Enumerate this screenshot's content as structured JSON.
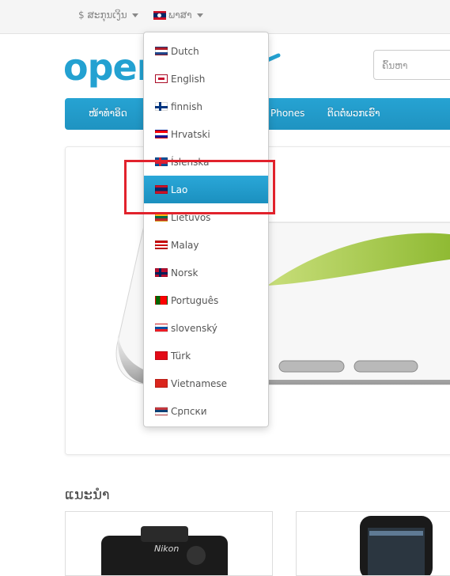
{
  "topbar": {
    "currency_label": "$ ສະກຸນເງິນ",
    "language_label": "ພາສາ"
  },
  "logo": {
    "text": "open"
  },
  "search": {
    "placeholder": "ຄົ້ນຫາ"
  },
  "menu": {
    "items": [
      "ໜ້າທຳອິດ",
      "Phones",
      "ຕິດຕໍ່ພວກເຮົາ"
    ]
  },
  "featured": {
    "title": "ແນະນຳ"
  },
  "languages": [
    {
      "label": "Dutch",
      "flag": "nl"
    },
    {
      "label": "English",
      "flag": "gb"
    },
    {
      "label": "finnish",
      "flag": "fi"
    },
    {
      "label": "Hrvatski",
      "flag": "hr"
    },
    {
      "label": "Íslenska",
      "flag": "is"
    },
    {
      "label": "Lao",
      "flag": "la",
      "active": true
    },
    {
      "label": "Lietuvos",
      "flag": "lt"
    },
    {
      "label": "Malay",
      "flag": "my"
    },
    {
      "label": "Norsk",
      "flag": "no"
    },
    {
      "label": "Português",
      "flag": "pt"
    },
    {
      "label": "slovenský",
      "flag": "sk"
    },
    {
      "label": "Türk",
      "flag": "tr"
    },
    {
      "label": "Vietnamese",
      "flag": "vn"
    },
    {
      "label": "Српски",
      "flag": "rs"
    }
  ],
  "colors": {
    "accent": "#23a1d1",
    "highlight": "#e1222c"
  }
}
